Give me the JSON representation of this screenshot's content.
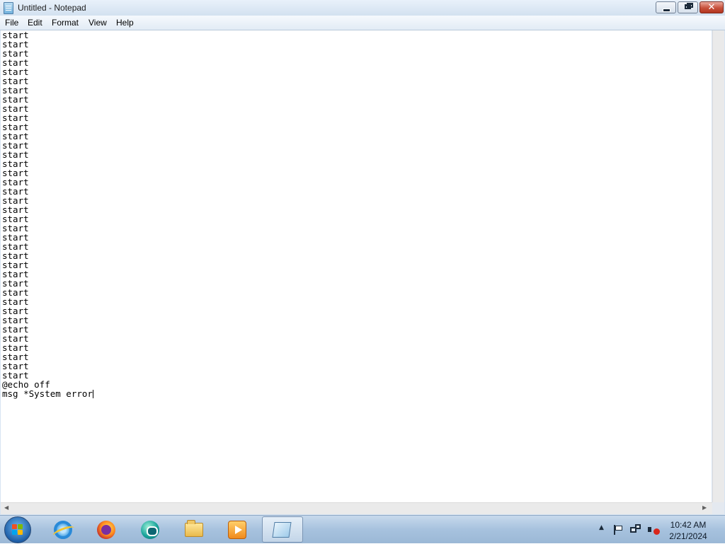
{
  "window": {
    "title": "Untitled - Notepad",
    "close_glyph": "✕"
  },
  "menu": {
    "items": [
      "File",
      "Edit",
      "Format",
      "View",
      "Help"
    ]
  },
  "editor": {
    "lines": [
      "start",
      "start",
      "start",
      "start",
      "start",
      "start",
      "start",
      "start",
      "start",
      "start",
      "start",
      "start",
      "start",
      "start",
      "start",
      "start",
      "start",
      "start",
      "start",
      "start",
      "start",
      "start",
      "start",
      "start",
      "start",
      "start",
      "start",
      "start",
      "start",
      "start",
      "start",
      "start",
      "start",
      "start",
      "start",
      "start",
      "start",
      "start",
      "@echo off",
      "msg *System error"
    ]
  },
  "scrollbar": {
    "left_arrow": "◀",
    "right_arrow": "▶"
  },
  "taskbar": {
    "pinned": [
      {
        "name": "internet-explorer",
        "icon": "ie-icon"
      },
      {
        "name": "firefox",
        "icon": "firefox-icon"
      },
      {
        "name": "chat",
        "icon": "chat-icon"
      },
      {
        "name": "file-explorer",
        "icon": "folder-icon"
      },
      {
        "name": "media-player",
        "icon": "media-icon"
      },
      {
        "name": "notepad",
        "icon": "notepad-icon",
        "active": true
      }
    ],
    "start_colors": [
      "#f25022",
      "#7fba00",
      "#00a4ef",
      "#ffb900"
    ]
  },
  "tray": {
    "up_arrow": "▲",
    "time": "10:42 AM",
    "date": "2/21/2024"
  }
}
